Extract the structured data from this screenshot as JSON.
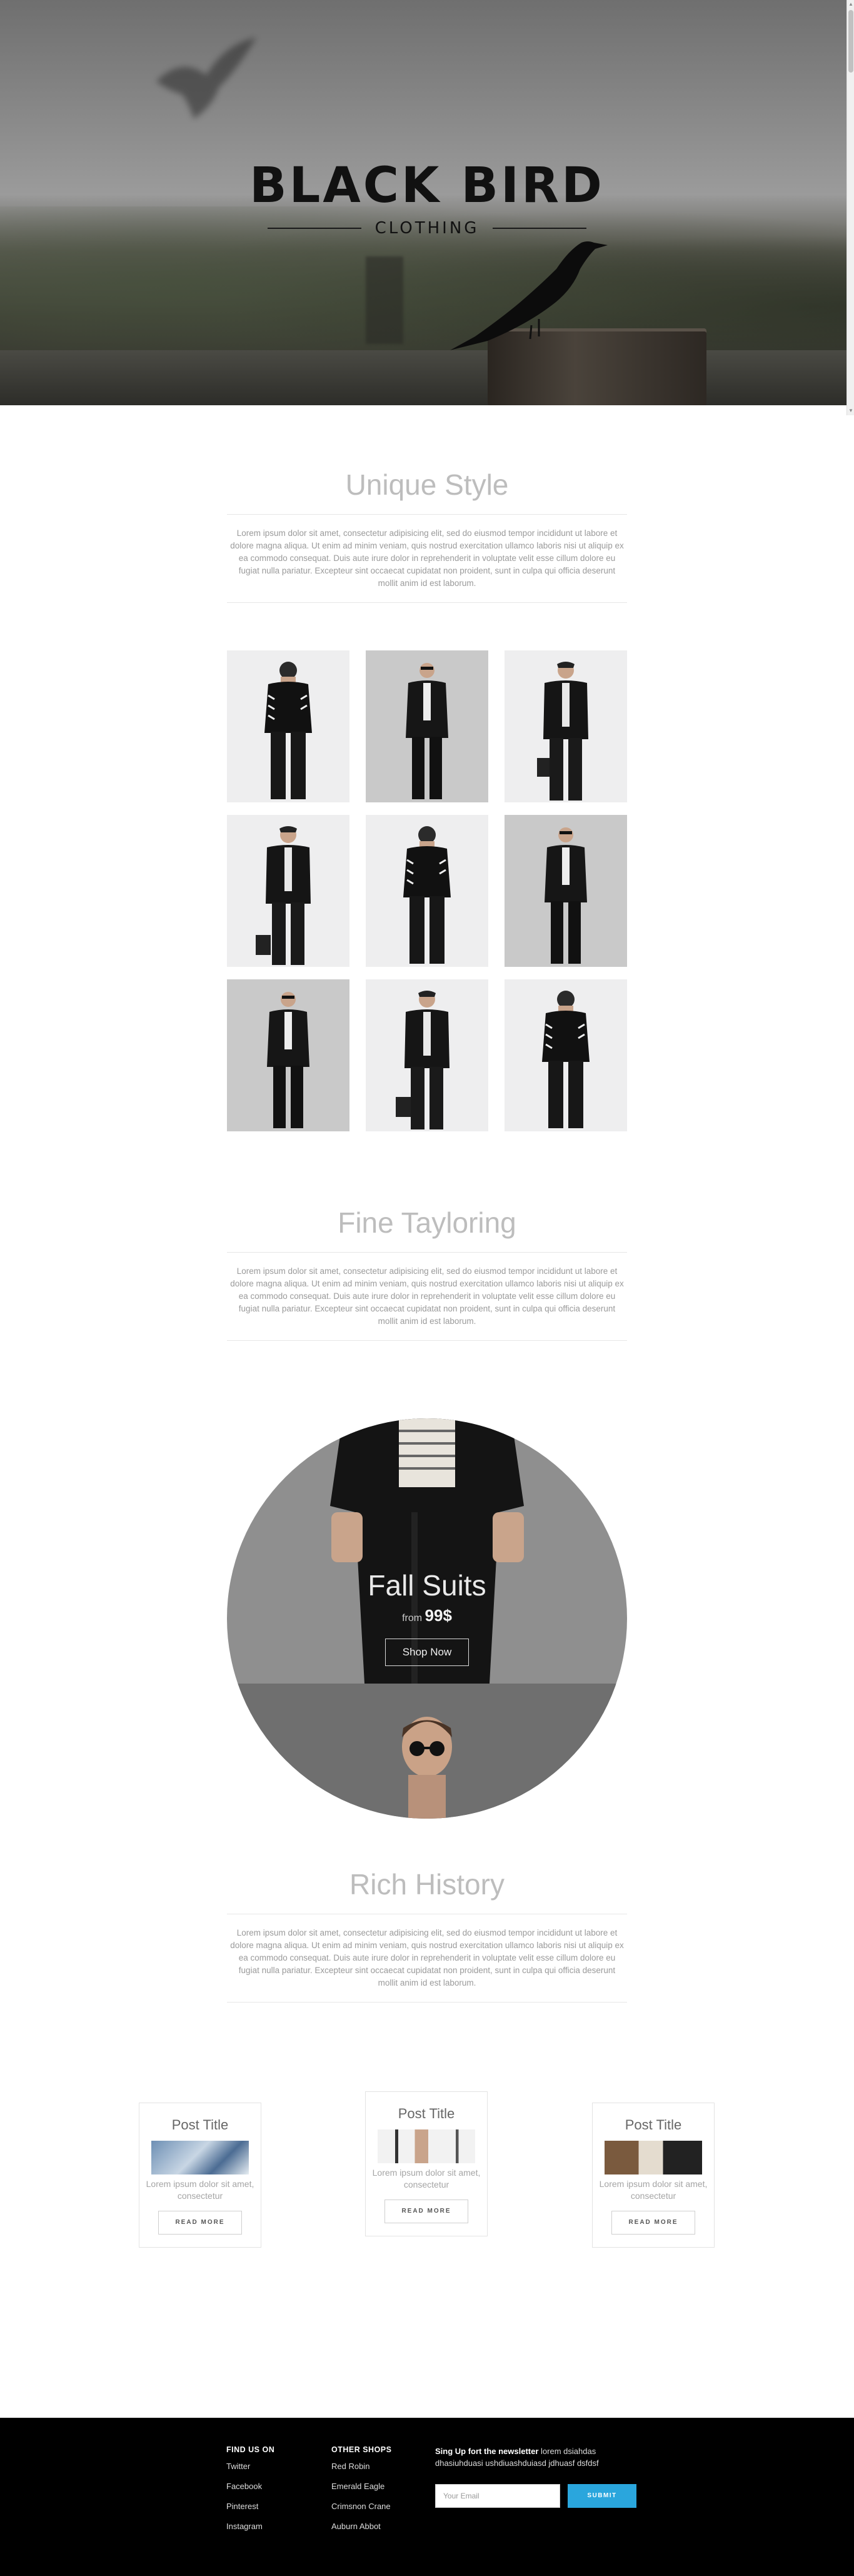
{
  "hero": {
    "brand": "BLACK BIRD",
    "subtitle": "CLOTHING"
  },
  "sections": [
    {
      "title": "Unique Style",
      "text": "Lorem ipsum dolor sit amet, consectetur adipisicing elit, sed do eiusmod tempor incididunt ut labore et dolore magna aliqua. Ut enim ad minim veniam, quis nostrud exercitation ullamco laboris nisi ut aliquip ex ea commodo consequat. Duis aute irure dolor in reprehenderit in voluptate velit esse cillum dolore eu fugiat nulla pariatur. Excepteur sint occaecat cupidatat non proident, sunt in culpa qui officia deserunt mollit anim id est laborum."
    },
    {
      "title": "Fine Tayloring",
      "text": "Lorem ipsum dolor sit amet, consectetur adipisicing elit, sed do eiusmod tempor incididunt ut labore et dolore magna aliqua. Ut enim ad minim veniam, quis nostrud exercitation ullamco laboris nisi ut aliquip ex ea commodo consequat. Duis aute irure dolor in reprehenderit in voluptate velit esse cillum dolore eu fugiat nulla pariatur. Excepteur sint occaecat cupidatat non proident, sunt in culpa qui officia deserunt mollit anim id est laborum."
    },
    {
      "title": "Rich History",
      "text": "Lorem ipsum dolor sit amet, consectetur adipisicing elit, sed do eiusmod tempor incididunt ut labore et dolore magna aliqua. Ut enim ad minim veniam, quis nostrud exercitation ullamco laboris nisi ut aliquip ex ea commodo consequat. Duis aute irure dolor in reprehenderit in voluptate velit esse cillum dolore eu fugiat nulla pariatur. Excepteur sint occaecat cupidatat non proident, sunt in culpa qui officia deserunt mollit anim id est laborum."
    }
  ],
  "promo": {
    "title": "Fall Suits",
    "price_prefix": "from",
    "price": "99$",
    "button": "Shop Now"
  },
  "posts": [
    {
      "title": "Post Title",
      "body": "Lorem ipsum dolor sit amet, consectetur",
      "button": "READ MORE"
    },
    {
      "title": "Post Title",
      "body": "Lorem ipsum dolor sit amet, consectetur",
      "button": "READ MORE"
    },
    {
      "title": "Post Title",
      "body": "Lorem ipsum dolor sit amet, consectetur",
      "button": "READ MORE"
    }
  ],
  "footer": {
    "find_us": {
      "heading": "FIND US ON",
      "links": [
        "Twitter",
        "Facebook",
        "Pinterest",
        "Instagram"
      ]
    },
    "shops": {
      "heading": "OTHER SHOPS",
      "links": [
        "Red Robin",
        "Emerald Eagle",
        "Crimsnon Crane",
        "Auburn Abbot"
      ]
    },
    "newsletter": {
      "lead": "Sing Up fort the newsletter",
      "text": "lorem dsiahdas dhasiuhduasi ushdiuashduiasd jdhuasf dsfdsf",
      "email_placeholder": "Your Email",
      "submit": "SUBMIT"
    }
  },
  "colors": {
    "accent": "#2aa6dd",
    "footer_bg": "#000000",
    "heading": "#bdbdbd"
  }
}
